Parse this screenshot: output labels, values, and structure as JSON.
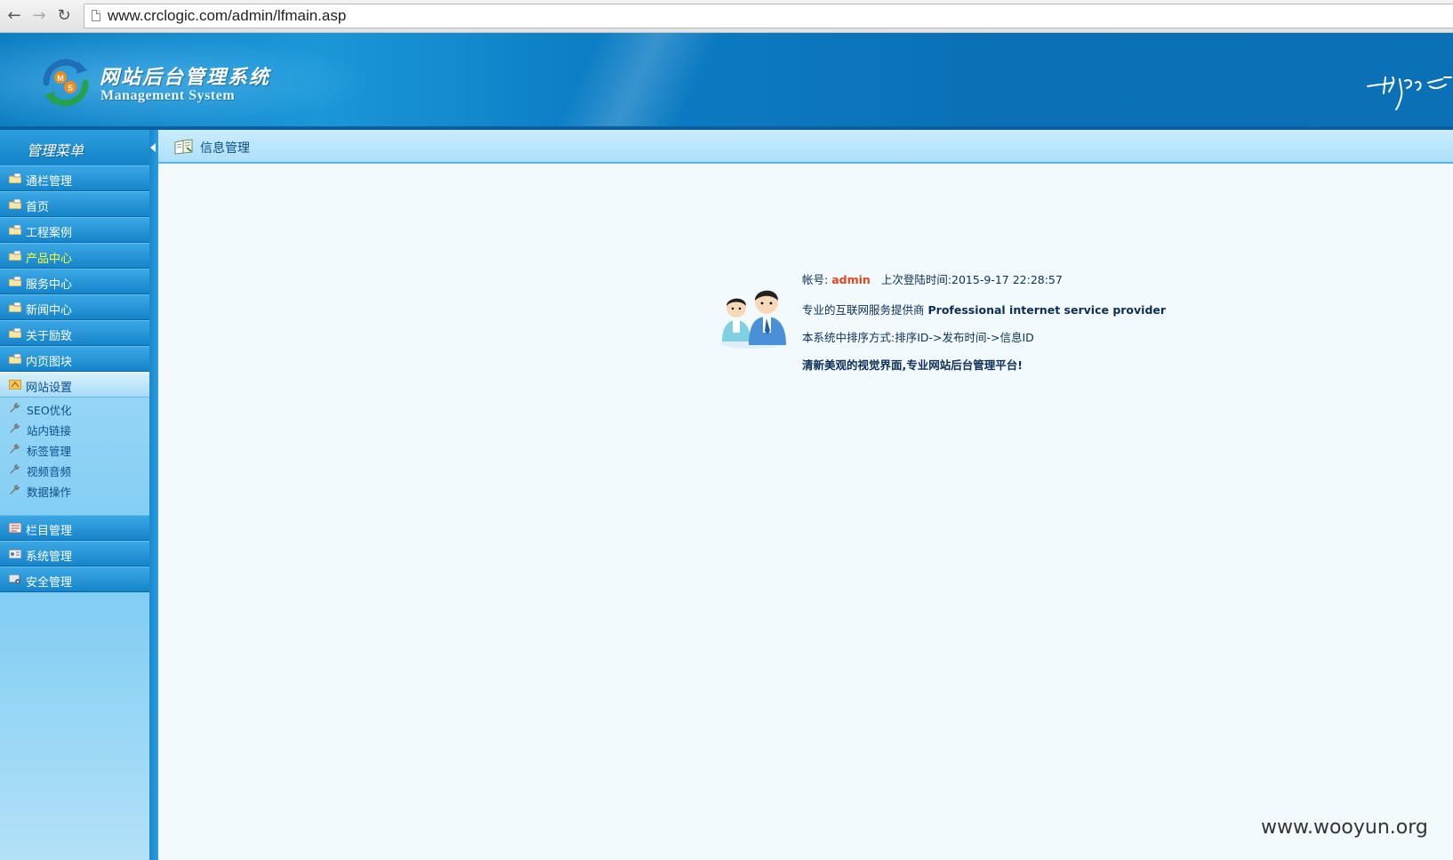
{
  "browser": {
    "back_icon": "back-arrow-icon",
    "forward_icon": "forward-arrow-icon",
    "reload_icon": "reload-icon",
    "url": "www.crclogic.com/admin/lfmain.asp"
  },
  "header": {
    "title": "网站后台管理系统",
    "subtitle": "Management System",
    "logo_letters": [
      "M",
      "S"
    ],
    "signature_icon": "handwritten-signature-icon"
  },
  "sidebar": {
    "title": "管理菜单",
    "items": [
      {
        "label": "通栏管理"
      },
      {
        "label": "首页"
      },
      {
        "label": "工程案例"
      },
      {
        "label": "产品中心"
      },
      {
        "label": "服务中心"
      },
      {
        "label": "新闻中心"
      },
      {
        "label": "关于励致"
      },
      {
        "label": "内页图块"
      },
      {
        "label": "网站设置"
      }
    ],
    "submenu": [
      {
        "label": "SEO优化"
      },
      {
        "label": "站内链接"
      },
      {
        "label": "标签管理"
      },
      {
        "label": "视频音频"
      },
      {
        "label": "数据操作"
      }
    ],
    "bottom_items": [
      {
        "label": "栏目管理"
      },
      {
        "label": "系统管理"
      },
      {
        "label": "安全管理"
      }
    ]
  },
  "main": {
    "title": "信息管理",
    "account_label": "帐号:",
    "account_value": "admin",
    "last_login_label": "上次登陆时间:",
    "last_login_value": "2015-9-17 22:28:57",
    "provider_cn": "专业的互联网服务提供商",
    "provider_en": "Professional internet service provider",
    "sort_line": "本系统中排序方式:排序ID->发布时间->信息ID",
    "slogan": "清新美观的视觉界面,专业网站后台管理平台!"
  },
  "watermark": "www.wooyun.org",
  "colors": {
    "header_blue": "#0e7fc2",
    "sidebar_blue": "#1684ca",
    "highlight_yellow": "#f7ff3a",
    "account_orange": "#e0461e",
    "text_navy": "#0b2f57"
  }
}
